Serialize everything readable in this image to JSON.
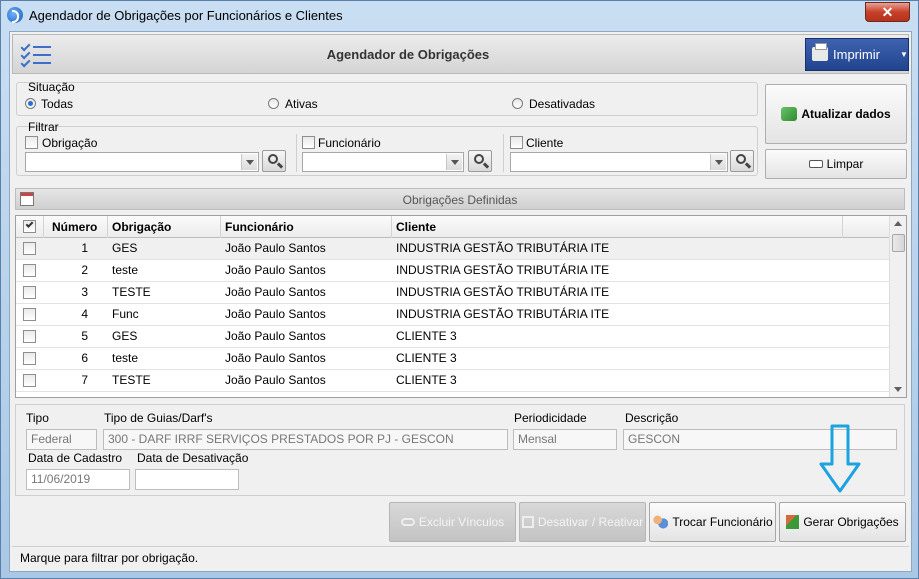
{
  "window": {
    "title": "Agendador de Obrigações por Funcionários e Clientes",
    "close_glyph": "✕"
  },
  "header": {
    "title": "Agendador de Obrigações",
    "print_label": "Imprimir"
  },
  "situacao": {
    "label": "Situação",
    "options": [
      {
        "label": "Todas",
        "selected": true
      },
      {
        "label": "Ativas",
        "selected": false
      },
      {
        "label": "Desativadas",
        "selected": false
      }
    ]
  },
  "filtrar": {
    "label": "Filtrar",
    "obrigacao_label": "Obrigação",
    "funcionario_label": "Funcionário",
    "cliente_label": "Cliente"
  },
  "side_buttons": {
    "atualizar_label": "Atualizar dados",
    "limpar_label": "Limpar"
  },
  "section": {
    "title": "Obrigações Definidas"
  },
  "grid": {
    "columns": [
      "Número",
      "Obrigação",
      "Funcionário",
      "Cliente"
    ],
    "rows": [
      {
        "numero": "1",
        "obrigacao": "GES",
        "funcionario": "João Paulo Santos",
        "cliente": "INDUSTRIA GESTÃO TRIBUTÁRIA ITE"
      },
      {
        "numero": "2",
        "obrigacao": "teste",
        "funcionario": "João Paulo Santos",
        "cliente": "INDUSTRIA GESTÃO TRIBUTÁRIA ITE"
      },
      {
        "numero": "3",
        "obrigacao": "TESTE",
        "funcionario": "João Paulo Santos",
        "cliente": "INDUSTRIA GESTÃO TRIBUTÁRIA ITE"
      },
      {
        "numero": "4",
        "obrigacao": "Func",
        "funcionario": "João Paulo Santos",
        "cliente": "INDUSTRIA GESTÃO TRIBUTÁRIA ITE"
      },
      {
        "numero": "5",
        "obrigacao": "GES",
        "funcionario": "João Paulo Santos",
        "cliente": "CLIENTE 3"
      },
      {
        "numero": "6",
        "obrigacao": "teste",
        "funcionario": "João Paulo Santos",
        "cliente": "CLIENTE 3"
      },
      {
        "numero": "7",
        "obrigacao": "TESTE",
        "funcionario": "João Paulo Santos",
        "cliente": "CLIENTE 3"
      }
    ]
  },
  "details": {
    "tipo_label": "Tipo",
    "tipo_value": "Federal",
    "guias_label": "Tipo de Guias/Darf's",
    "guias_value": "300 - DARF IRRF SERVIÇOS PRESTADOS POR PJ - GESCON",
    "periodicidade_label": "Periodicidade",
    "periodicidade_value": "Mensal",
    "descricao_label": "Descrição",
    "descricao_value": "GESCON",
    "cadastro_label": "Data de Cadastro",
    "cadastro_value": "11/06/2019",
    "desativacao_label": "Data de Desativação",
    "desativacao_value": ""
  },
  "actions": {
    "excluir_label": "Excluir Vínculos",
    "desativar_label": "Desativar / Reativar",
    "trocar_label": "Trocar Funcionário",
    "gerar_label": "Gerar Obrigações"
  },
  "status": {
    "text": "Marque para filtrar por obrigação."
  },
  "colors": {
    "accent": "#2a4a9c",
    "annotation_arrow": "#1aa3e0"
  }
}
